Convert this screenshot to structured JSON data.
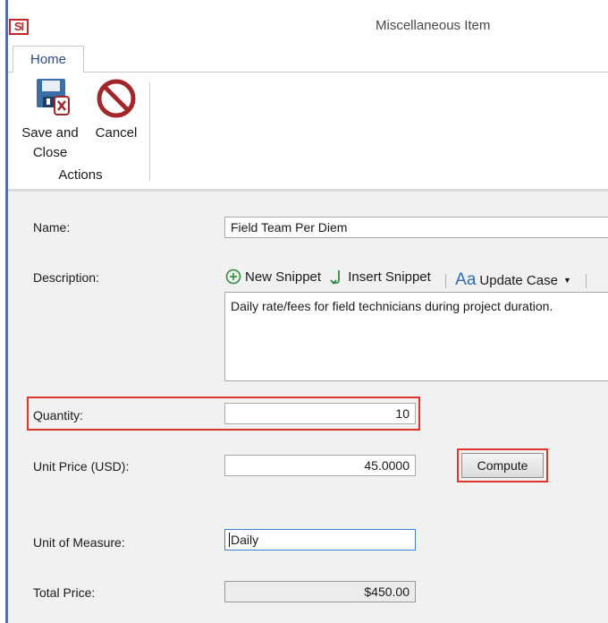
{
  "app": {
    "logo_text": "SI",
    "window_title": "Miscellaneous Item"
  },
  "ribbon": {
    "tabs": [
      {
        "label": "Home"
      }
    ],
    "actions": [
      {
        "label_line1": "Save and",
        "label_line2": "Close",
        "icon": "save-close-icon"
      },
      {
        "label_line1": "Cancel",
        "icon": "cancel-icon"
      }
    ],
    "group_label": "Actions"
  },
  "form": {
    "name": {
      "label": "Name:",
      "value": "Field Team Per Diem"
    },
    "description": {
      "label": "Description:",
      "toolbar": {
        "new_snippet": "New Snippet",
        "insert_snippet": "Insert Snippet",
        "update_case": "Update Case"
      },
      "value": "Daily rate/fees for field technicians during project duration."
    },
    "quantity": {
      "label": "Quantity:",
      "value": "10"
    },
    "unit_price": {
      "label": "Unit Price (USD):",
      "value": "45.0000"
    },
    "compute_button": "Compute",
    "unit_of_measure": {
      "label": "Unit of Measure:",
      "value": "Daily"
    },
    "total_price": {
      "label": "Total Price:",
      "value": "$450.00"
    }
  },
  "colors": {
    "accent": "#2b4a8a",
    "highlight": "#e0342a",
    "cancel_red": "#a3262a",
    "snippet_green": "#2e8b3a"
  }
}
